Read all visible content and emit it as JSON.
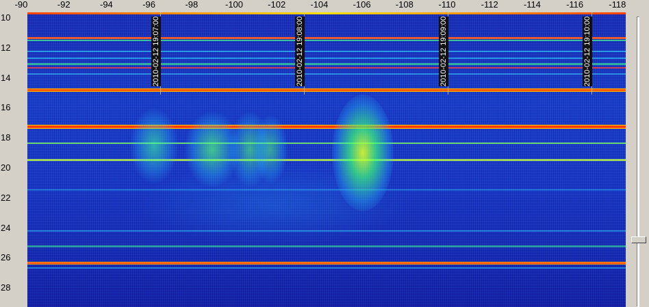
{
  "x_axis": {
    "ticks": [
      "-90",
      "-92",
      "-94",
      "-96",
      "-98",
      "-100",
      "-102",
      "-104",
      "-106",
      "-108",
      "-110",
      "-112",
      "-114",
      "-116",
      "-118"
    ]
  },
  "y_axis": {
    "ticks": [
      "10",
      "12",
      "14",
      "16",
      "18",
      "20",
      "22",
      "24",
      "26",
      "28"
    ]
  },
  "timestamps": [
    "2010-02-12 19:07:00",
    "2010-02-12 19:08:00",
    "2010-02-12 19:09:00",
    "2010-02-12 19:10:00"
  ],
  "scrollbar": {
    "position": 0.78
  },
  "colors": {
    "background": "#1b2fb8",
    "strong_line": "#ff2020",
    "medium_line": "#ffd000",
    "signal": "#30ff80"
  }
}
